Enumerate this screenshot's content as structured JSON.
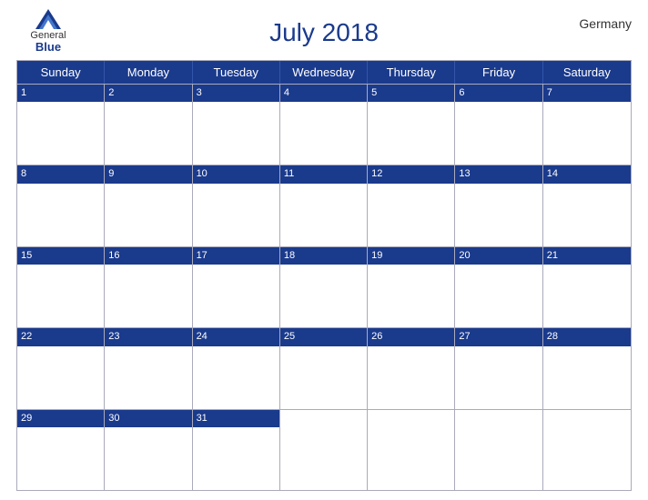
{
  "header": {
    "title": "July 2018",
    "country": "Germany",
    "logo": {
      "general": "General",
      "blue": "Blue"
    }
  },
  "days_of_week": [
    "Sunday",
    "Monday",
    "Tuesday",
    "Wednesday",
    "Thursday",
    "Friday",
    "Saturday"
  ],
  "weeks": [
    [
      1,
      2,
      3,
      4,
      5,
      6,
      7
    ],
    [
      8,
      9,
      10,
      11,
      12,
      13,
      14
    ],
    [
      15,
      16,
      17,
      18,
      19,
      20,
      21
    ],
    [
      22,
      23,
      24,
      25,
      26,
      27,
      28
    ],
    [
      29,
      30,
      31,
      null,
      null,
      null,
      null
    ]
  ]
}
